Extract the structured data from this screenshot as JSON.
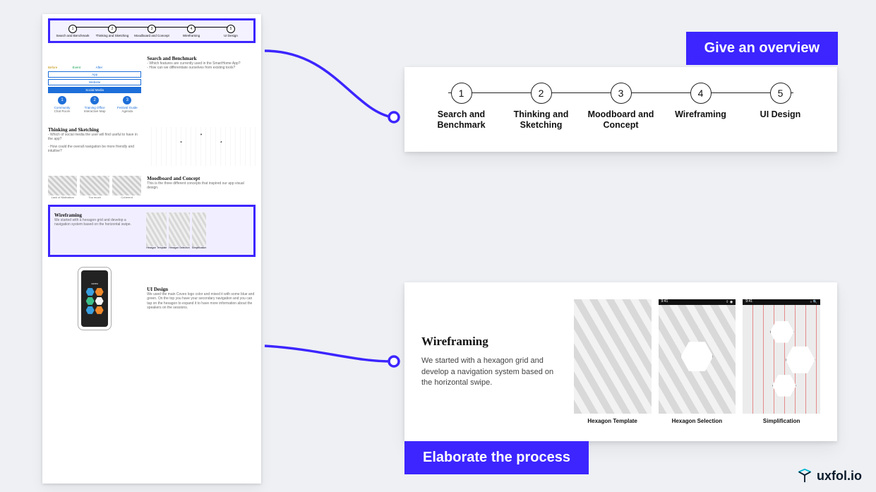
{
  "badges": {
    "overview": "Give an overview",
    "elaborate": "Elaborate the process"
  },
  "steps": [
    {
      "num": "1",
      "label": "Search and Benchmark"
    },
    {
      "num": "2",
      "label": "Thinking and Sketching"
    },
    {
      "num": "3",
      "label": "Moodboard and Concept"
    },
    {
      "num": "4",
      "label": "Wireframing"
    },
    {
      "num": "5",
      "label": "UI Design"
    }
  ],
  "wire_card": {
    "title": "Wireframing",
    "body": "We started with a hexagon grid and develop a navigation system based on the horizontal swipe.",
    "thumbs": [
      "Hexagon Template",
      "Hexagon Selection",
      "Simplification"
    ]
  },
  "thumb_page": {
    "search": {
      "title": "Search and Benchmark",
      "q1": "- Which features are currently used in the SmartHome App?",
      "q2": "- How can we differentiate ourselves from existing tools?"
    },
    "tabs": {
      "before": "Before",
      "event": "Event",
      "after": "After",
      "app": "App",
      "website": "Website",
      "social": "Social Media"
    },
    "circles": [
      {
        "n": "1",
        "l1": "Community",
        "l2": "Chat Room"
      },
      {
        "n": "2",
        "l1": "Training Office",
        "l2": "Interactive Map"
      },
      {
        "n": "3",
        "l1": "Festival Guide",
        "l2": "Agenda"
      }
    ],
    "thinking": {
      "title": "Thinking and Sketching",
      "q1": "- Which of social media the user will find useful to have in the app?",
      "q2": "- How could the overall navigation be more friendly and intuitive?"
    },
    "mood": {
      "title": "Moodboard and Concept",
      "body": "This is the three different concepts that inspired our app visual design.",
      "caps": [
        "Lack of Motivation",
        "Too much",
        "Coherent"
      ]
    },
    "wire": {
      "title": "Wireframing",
      "body": "We started with a hexagon grid and develop a navigation system based on the horizontal swipe.",
      "caps": [
        "Hexagon Template",
        "Hexagon Selection",
        "Simplification"
      ]
    },
    "ui": {
      "title": "UI Design",
      "body": "We used the main Coveo logo color and mixed it with some blue and green. On the top you have your secondary navigation and you can tap on the hexagon to expand it to have more information about the speakers on the sessions.",
      "logo": "coveo"
    }
  },
  "brand": "uxfol.io"
}
